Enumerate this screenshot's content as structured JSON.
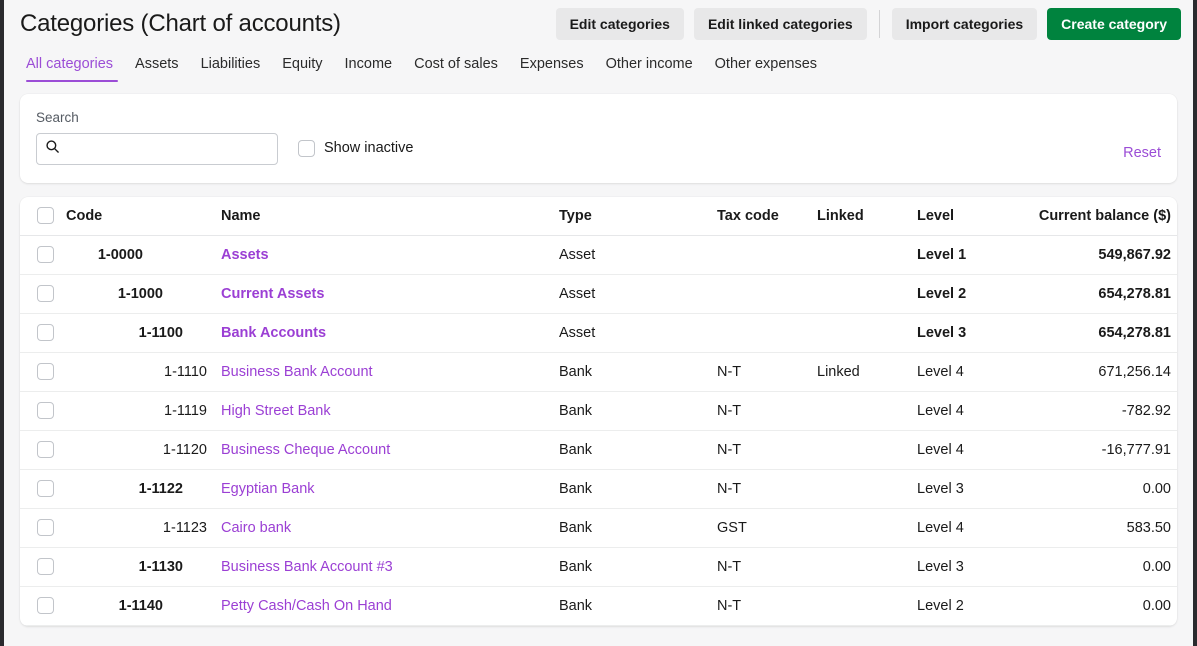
{
  "header": {
    "title": "Categories (Chart of accounts)",
    "buttons": [
      {
        "label": "Edit categories",
        "style": "secondary"
      },
      {
        "label": "Edit linked categories",
        "style": "secondary"
      },
      {
        "label": "Import categories",
        "style": "secondary"
      },
      {
        "label": "Create category",
        "style": "primary"
      }
    ],
    "primary_color": "#00833e"
  },
  "tabs": {
    "active_index": 0,
    "accent_color": "#9b4dd6",
    "items": [
      {
        "label": "All categories"
      },
      {
        "label": "Assets"
      },
      {
        "label": "Liabilities"
      },
      {
        "label": "Equity"
      },
      {
        "label": "Income"
      },
      {
        "label": "Cost of sales"
      },
      {
        "label": "Expenses"
      },
      {
        "label": "Other income"
      },
      {
        "label": "Other expenses"
      }
    ]
  },
  "filters": {
    "search_label": "Search",
    "search_value": "",
    "search_placeholder": "",
    "search_icon": "search-icon",
    "show_inactive_label": "Show inactive",
    "show_inactive_checked": false,
    "reset_label": "Reset"
  },
  "table": {
    "select_all_checked": false,
    "columns": [
      {
        "key": "code",
        "label": "Code"
      },
      {
        "key": "name",
        "label": "Name"
      },
      {
        "key": "type",
        "label": "Type"
      },
      {
        "key": "tax",
        "label": "Tax code"
      },
      {
        "key": "link",
        "label": "Linked"
      },
      {
        "key": "level",
        "label": "Level"
      },
      {
        "key": "bal",
        "label": "Current balance ($)"
      }
    ],
    "link_color": "#9b3fd4",
    "rows": [
      {
        "code": "1-0000",
        "name": "Assets",
        "type": "Asset",
        "tax": "",
        "link": "",
        "level": "Level 1",
        "bal": "549,867.92",
        "depth": 1,
        "bold": true
      },
      {
        "code": "1-1000",
        "name": "Current Assets",
        "type": "Asset",
        "tax": "",
        "link": "",
        "level": "Level 2",
        "bal": "654,278.81",
        "depth": 2,
        "bold": true
      },
      {
        "code": "1-1100",
        "name": "Bank Accounts",
        "type": "Asset",
        "tax": "",
        "link": "",
        "level": "Level 3",
        "bal": "654,278.81",
        "depth": 3,
        "bold": true
      },
      {
        "code": "1-1110",
        "name": "Business Bank Account",
        "type": "Bank",
        "tax": "N-T",
        "link": "Linked",
        "level": "Level 4",
        "bal": "671,256.14",
        "depth": 4,
        "bold": false
      },
      {
        "code": "1-1119",
        "name": "High Street Bank",
        "type": "Bank",
        "tax": "N-T",
        "link": "",
        "level": "Level 4",
        "bal": "-782.92",
        "depth": 4,
        "bold": false
      },
      {
        "code": "1-1120",
        "name": "Business Cheque Account",
        "type": "Bank",
        "tax": "N-T",
        "link": "",
        "level": "Level 4",
        "bal": "-16,777.91",
        "depth": 4,
        "bold": false
      },
      {
        "code": "1-1122",
        "name": "Egyptian Bank",
        "type": "Bank",
        "tax": "N-T",
        "link": "",
        "level": "Level 3",
        "bal": "0.00",
        "depth": 3,
        "bold": false
      },
      {
        "code": "1-1123",
        "name": "Cairo bank",
        "type": "Bank",
        "tax": "GST",
        "link": "",
        "level": "Level 4",
        "bal": "583.50",
        "depth": 4,
        "bold": false
      },
      {
        "code": "1-1130",
        "name": "Business Bank Account #3",
        "type": "Bank",
        "tax": "N-T",
        "link": "",
        "level": "Level 3",
        "bal": "0.00",
        "depth": 3,
        "bold": false
      },
      {
        "code": "1-1140",
        "name": "Petty Cash/Cash On Hand",
        "type": "Bank",
        "tax": "N-T",
        "link": "",
        "level": "Level 2",
        "bal": "0.00",
        "depth": 2,
        "bold": false
      }
    ]
  }
}
